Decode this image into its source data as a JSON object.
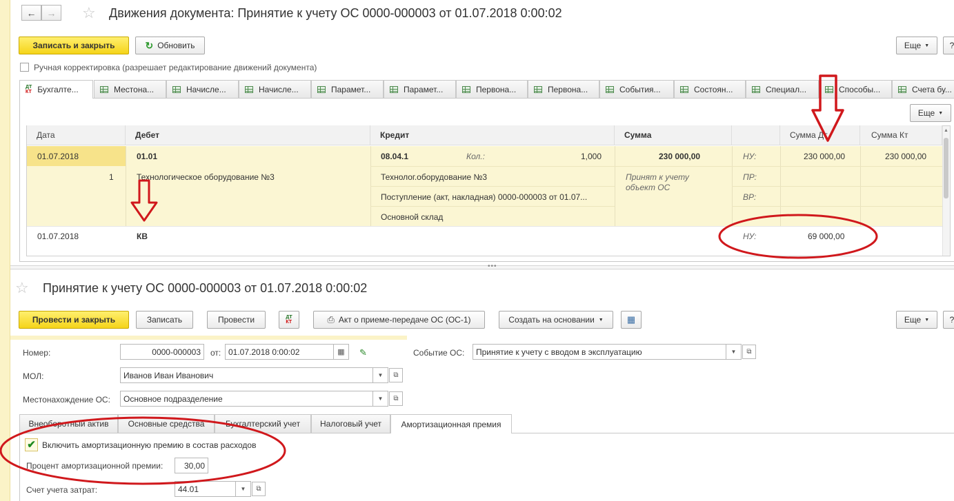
{
  "movements_window": {
    "title": "Движения документа: Принятие к учету ОС 0000-000003 от 01.07.2018 0:00:02",
    "write_close_label": "Записать и закрыть",
    "refresh_label": "Обновить",
    "more_label": "Еще",
    "manual_correction_label": "Ручная корректировка (разрешает редактирование движений документа)",
    "tabs": [
      "Бухгалте...",
      "Местона...",
      "Начисле...",
      "Начисле...",
      "Парамет...",
      "Парамет...",
      "Первона...",
      "Первона...",
      "События...",
      "Состоян...",
      "Специал...",
      "Способы...",
      "Счета бу..."
    ],
    "table_more_label": "Еще",
    "columns": [
      "Дата",
      "Дебет",
      "Кредит",
      "Сумма",
      "Сумма Дт",
      "Сумма Кт"
    ],
    "rows": [
      {
        "date": "01.07.2018",
        "row_no": "1",
        "debit_account": "01.01",
        "debit_sub1": "Технологическое оборудование №3",
        "credit_account": "08.04.1",
        "qty_label": "Кол.:",
        "qty_value": "1,000",
        "credit_sub1": "Технолог.оборудование №3",
        "credit_sub2": "Поступление (акт, накладная) 0000-000003 от 01.07...",
        "credit_sub3": "Основной склад",
        "amount": "230 000,00",
        "content_line1": "Принят к учету",
        "content_line2": "объект ОС",
        "nu_label": "НУ:",
        "pr_label": "ПР:",
        "vr_label": "ВР:",
        "sum_dt": "230 000,00",
        "sum_kt": "230 000,00"
      },
      {
        "date": "01.07.2018",
        "debit_account": "КВ",
        "nu_label": "НУ:",
        "sum_dt": "69 000,00"
      }
    ]
  },
  "document_window": {
    "title": "Принятие к учету ОС 0000-000003 от 01.07.2018 0:00:02",
    "post_close_label": "Провести и закрыть",
    "write_label": "Записать",
    "post_label": "Провести",
    "act_label": "Акт о приеме-передаче ОС (ОС-1)",
    "create_based_label": "Создать на основании",
    "more_label": "Еще",
    "number_label": "Номер:",
    "number_value": "0000-000003",
    "from_label": "от:",
    "date_value": "01.07.2018  0:00:02",
    "event_label": "Событие ОС:",
    "event_value": "Принятие к учету с вводом в эксплуатацию",
    "mol_label": "МОЛ:",
    "mol_value": "Иванов Иван Иванович",
    "location_label": "Местонахождение ОС:",
    "location_value": "Основное подразделение",
    "tabs": [
      "Внеоборотный актив",
      "Основные средства",
      "Бухгалтерский учет",
      "Налоговый учет",
      "Амортизационная премия"
    ],
    "include_premium_label": "Включить амортизационную премию в состав расходов",
    "premium_percent_label": "Процент амортизационной премии:",
    "premium_percent_value": "30,00",
    "cost_account_label": "Счет учета затрат:",
    "cost_account_value": "44.01"
  },
  "colors": {
    "accent_yellow": "#f5d419",
    "selected_row": "#fbf6d3",
    "annotation_red": "#d0181c",
    "left_stripe": "#f3e9a6"
  }
}
